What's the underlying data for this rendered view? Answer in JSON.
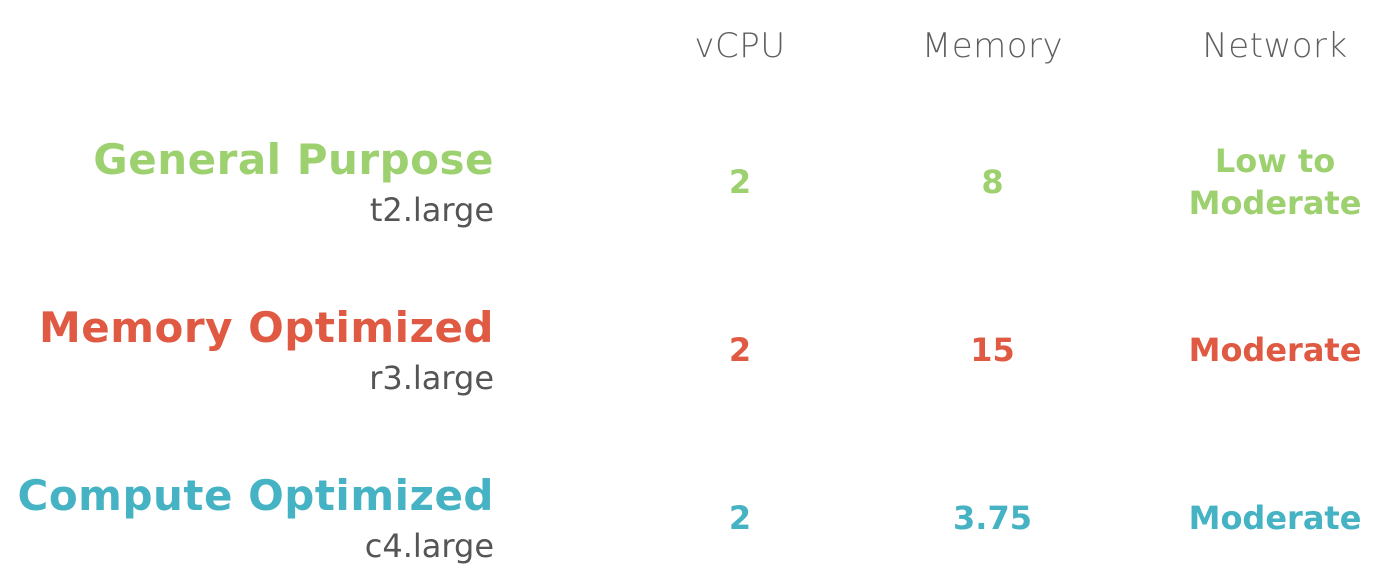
{
  "colors": {
    "general": "#9dd170",
    "memory": "#e05a43",
    "compute": "#45b3c3",
    "header_text": "#5f5f5f",
    "subtext": "#555555"
  },
  "columns": {
    "vcpu": "vCPU",
    "memory": "Memory",
    "network": "Network"
  },
  "rows": [
    {
      "title": "General Purpose",
      "instance": "t2.large",
      "vcpu": "2",
      "memory": "8",
      "network": "Low to Moderate"
    },
    {
      "title": "Memory Optimized",
      "instance": "r3.large",
      "vcpu": "2",
      "memory": "15",
      "network": "Moderate"
    },
    {
      "title": "Compute Optimized",
      "instance": "c4.large",
      "vcpu": "2",
      "memory": "3.75",
      "network": "Moderate"
    }
  ]
}
